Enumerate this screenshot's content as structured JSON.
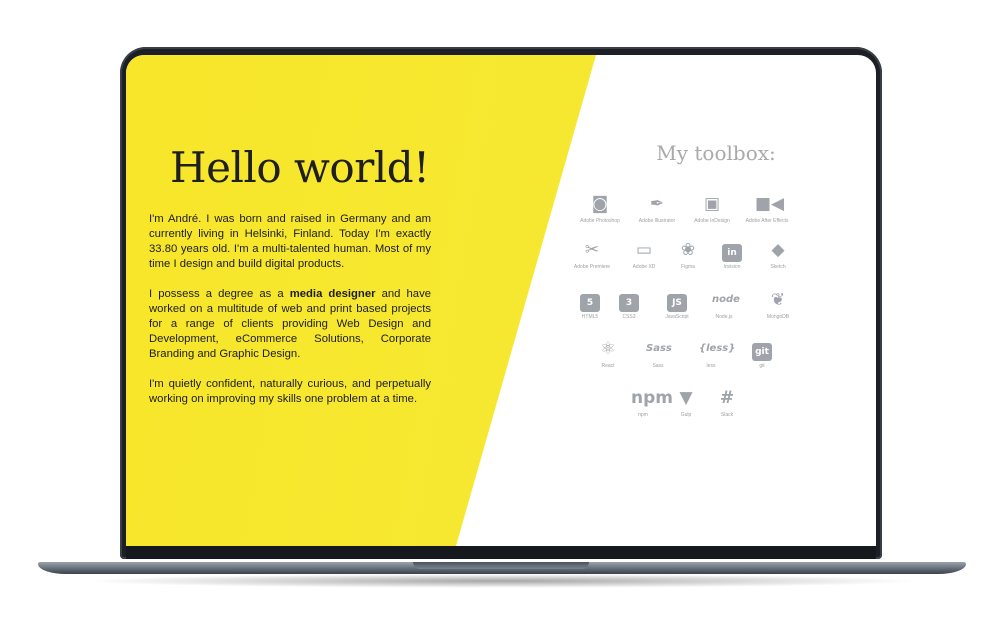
{
  "hero": {
    "title": "Hello world!"
  },
  "bio": {
    "p1": "I'm André. I was born and raised in Germany and am currently living in Helsinki, Finland. Today I'm exactly 33.80 years old. I'm a multi-talented human. Most of my time I design and build digital products.",
    "p2_before": "I possess a degree as a ",
    "p2_bold": "media designer",
    "p2_after": " and have worked on a multitude of web and print based projects for a range of clients providing Web Design and Development, eCommerce Solutions, Corporate Branding and Graphic Design.",
    "p3": "I'm quietly confident, naturally curious, and perpetually working on improving my skills one problem at a time."
  },
  "toolbox": {
    "title": "My toolbox:",
    "items": [
      {
        "label": "Adobe Photoshop",
        "icon": "photoshop-icon",
        "glyph": "◙"
      },
      {
        "label": "Adobe Illustrator",
        "icon": "illustrator-icon",
        "glyph": "✒"
      },
      {
        "label": "Adobe InDesign",
        "icon": "indesign-icon",
        "glyph": "▣"
      },
      {
        "label": "Adobe After Effects",
        "icon": "after-effects-icon",
        "glyph": "■◀"
      },
      {
        "label": "Adobe Premiere",
        "icon": "premiere-icon",
        "glyph": "✂"
      },
      {
        "label": "Adobe XD",
        "icon": "xd-icon",
        "glyph": "▭"
      },
      {
        "label": "Figma",
        "icon": "figma-icon",
        "glyph": "❀"
      },
      {
        "label": "Invision",
        "icon": "invision-icon",
        "glyph": "in"
      },
      {
        "label": "Sketch",
        "icon": "sketch-icon",
        "glyph": "◆"
      },
      {
        "label": "HTML5",
        "icon": "html5-icon",
        "glyph": "5"
      },
      {
        "label": "CSS3",
        "icon": "css3-icon",
        "glyph": "3"
      },
      {
        "label": "JavaScript",
        "icon": "javascript-icon",
        "glyph": "JS"
      },
      {
        "label": "Node.js",
        "icon": "nodejs-icon",
        "glyph": "node"
      },
      {
        "label": "MongoDB",
        "icon": "mongodb-icon",
        "glyph": "❦"
      },
      {
        "label": "React",
        "icon": "react-icon",
        "glyph": "⚛"
      },
      {
        "label": "Sass",
        "icon": "sass-icon",
        "glyph": "Sass"
      },
      {
        "label": "less",
        "icon": "less-icon",
        "glyph": "{less}"
      },
      {
        "label": "git",
        "icon": "git-icon",
        "glyph": "git"
      },
      {
        "label": "npm",
        "icon": "npm-icon",
        "glyph": "npm"
      },
      {
        "label": "Gulp",
        "icon": "gulp-icon",
        "glyph": "▼"
      },
      {
        "label": "Slack",
        "icon": "slack-icon",
        "glyph": "#"
      }
    ]
  },
  "colors": {
    "accent_yellow": "#f7e629",
    "icon_gray": "#9ea4aa",
    "laptop_frame": "#1c2026"
  }
}
